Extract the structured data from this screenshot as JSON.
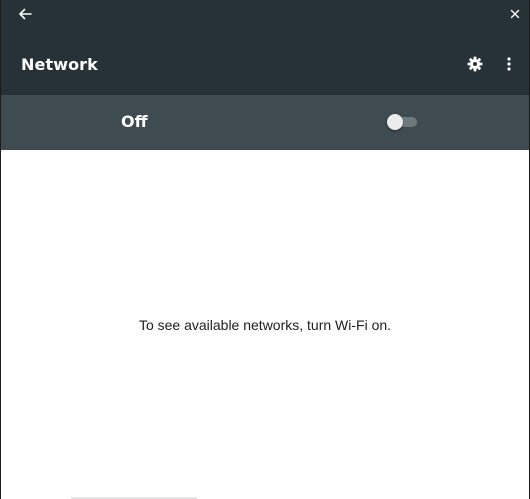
{
  "header": {
    "title": "Network",
    "back_icon": "arrow-left-icon",
    "close_icon": "close-icon",
    "settings_icon": "gear-icon",
    "more_icon": "more-vert-icon"
  },
  "wifi_toggle": {
    "label": "Off",
    "state": "off"
  },
  "main": {
    "message": "To see available networks, turn Wi-Fi on."
  },
  "colors": {
    "titlebar": "#273238",
    "togglebar": "#3e4b50",
    "background": "#ffffff",
    "text_light": "#ffffff",
    "text_dark": "#212121"
  }
}
